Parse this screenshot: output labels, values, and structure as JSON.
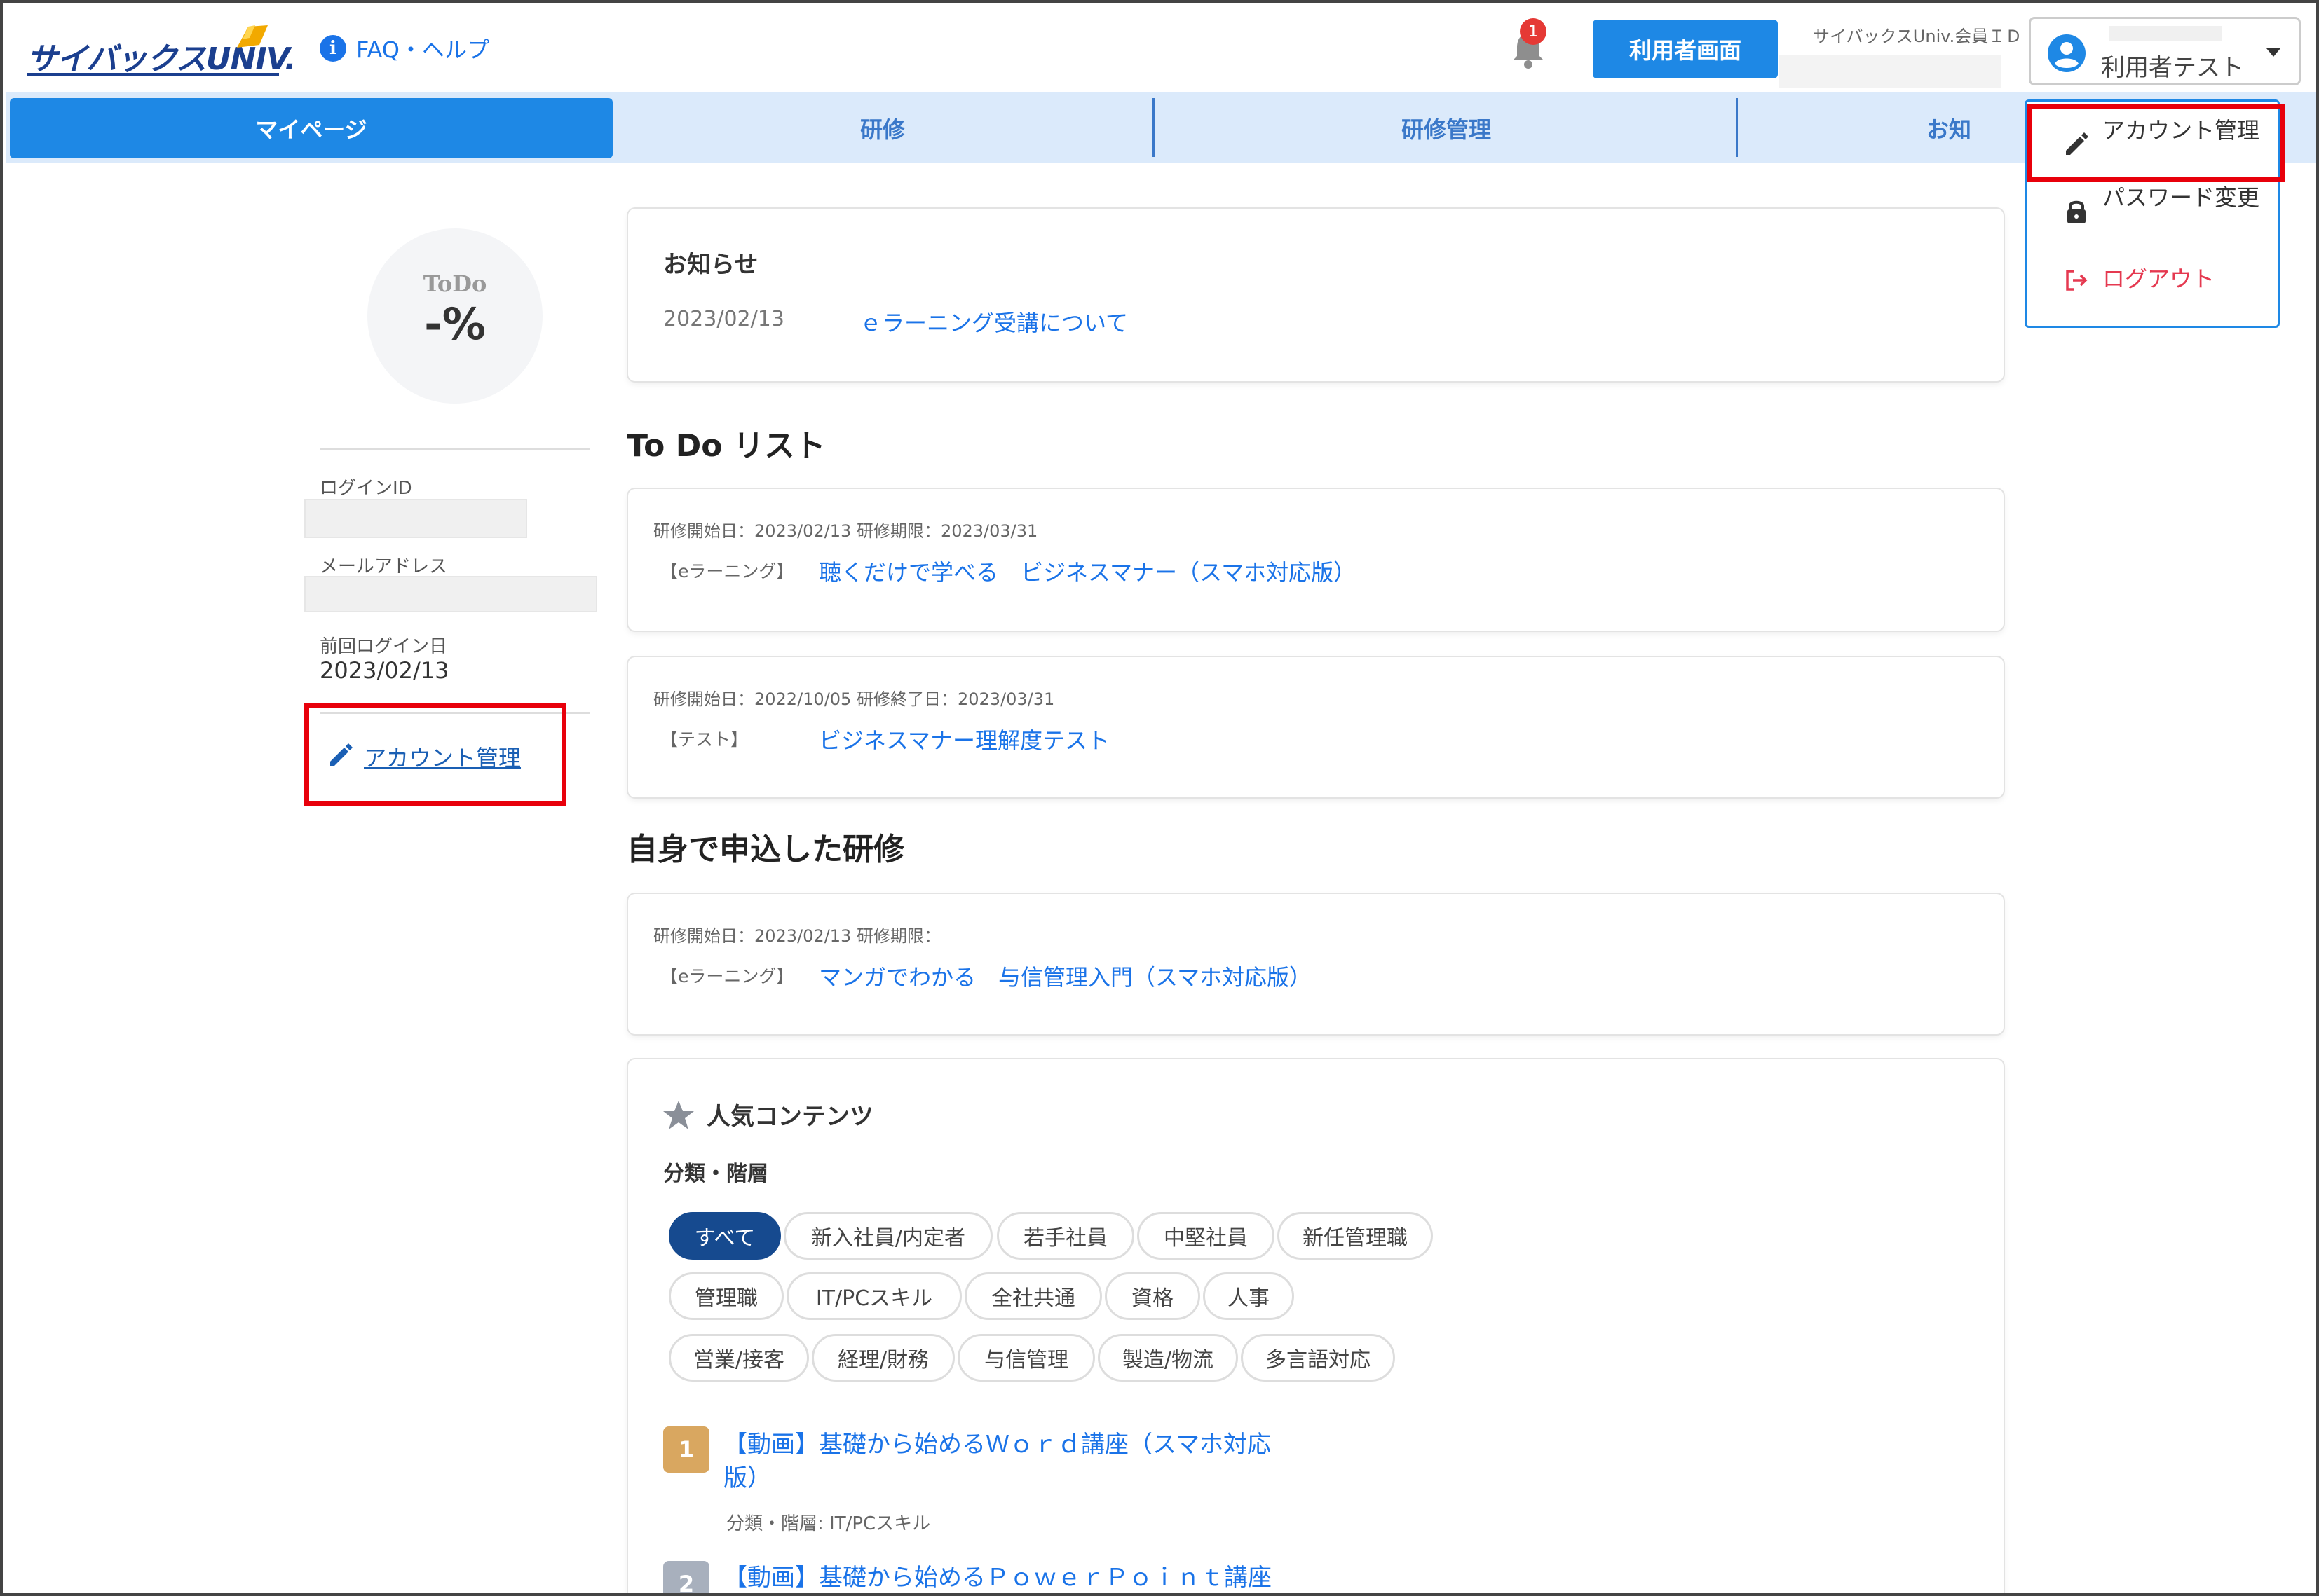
{
  "header": {
    "logo_text": "サイバックスUNIV.",
    "faq_label": "FAQ・ヘルプ",
    "notification_count": "1",
    "user_screen_button": "利用者画面",
    "member_id_label": "サイバックスUniv.会員ＩＤ",
    "user_name": "利用者テスト"
  },
  "nav": {
    "tabs": [
      {
        "label": "マイページ"
      },
      {
        "label": "研修"
      },
      {
        "label": "研修管理"
      },
      {
        "label": "お知"
      }
    ]
  },
  "sidebar": {
    "todo_label": "ToDo",
    "todo_value": "-%",
    "login_id_label": "ログインID",
    "email_label": "メールアドレス",
    "last_login_label": "前回ログイン日",
    "last_login_value": "2023/02/13",
    "account_link": "アカウント管理"
  },
  "news": {
    "title": "お知らせ",
    "items": [
      {
        "date": "2023/02/13",
        "text": "ｅラーニング受講について"
      }
    ]
  },
  "todo_list": {
    "title": "To Do リスト",
    "items": [
      {
        "meta": "研修開始日：2023/02/13 研修期限：2023/03/31",
        "tag": "【eラーニング】",
        "course": "聴くだけで学べる　ビジネスマナー（スマホ対応版）"
      },
      {
        "meta": "研修開始日：2022/10/05 研修終了日：2023/03/31",
        "tag": "【テスト】",
        "course": "ビジネスマナー理解度テスト"
      }
    ]
  },
  "applied": {
    "title": "自身で申込した研修",
    "items": [
      {
        "meta": "研修開始日：2023/02/13 研修期限：",
        "tag": "【eラーニング】",
        "course": "マンガでわかる　与信管理入門（スマホ対応版）"
      }
    ]
  },
  "popular": {
    "title": "人気コンテンツ",
    "category_label": "分類・階層",
    "chips": [
      "すべて",
      "新入社員/内定者",
      "若手社員",
      "中堅社員",
      "新任管理職",
      "管理職",
      "IT/PCスキル",
      "全社共通",
      "資格",
      "人事",
      "営業/接客",
      "経理/財務",
      "与信管理",
      "製造/物流",
      "多言語対応"
    ],
    "ranking": [
      {
        "rank": "1",
        "title": "【動画】基礎から始めるＷｏｒｄ講座（スマホ対応版）",
        "category": "分類・階層: IT/PCスキル"
      },
      {
        "rank": "2",
        "title": "【動画】基礎から始めるＰｏｗｅｒＰｏｉｎｔ講座"
      }
    ],
    "rank_colors": [
      "#d9a760",
      "#a8b0bd"
    ]
  },
  "dropdown": {
    "items": [
      {
        "label": "アカウント管理",
        "icon": "pencil-icon"
      },
      {
        "label": "パスワード変更",
        "icon": "lock-icon"
      },
      {
        "label": "ログアウト",
        "icon": "logout-icon"
      }
    ]
  },
  "colors": {
    "accent": "#1e88e5",
    "highlight": "#e8000b",
    "logout": "#e53950"
  }
}
